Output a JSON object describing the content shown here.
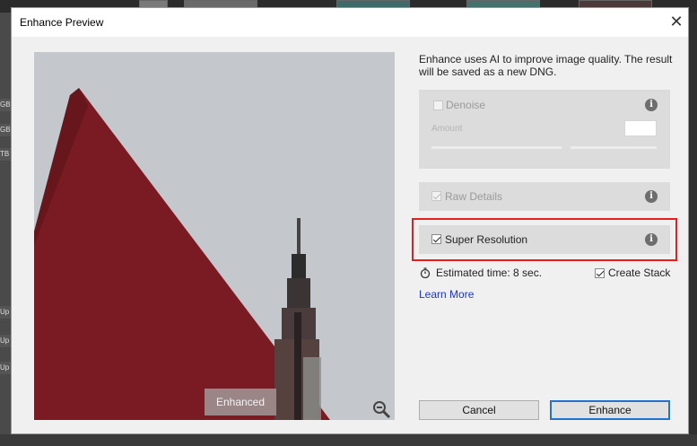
{
  "dialog": {
    "title": "Enhance Preview",
    "close_glyph": "✕",
    "description": "Enhance uses AI to improve image quality. The result will be saved as a new DNG."
  },
  "preview": {
    "overlay_label": "Enhanced",
    "zoom_icon": "zoom-out-icon"
  },
  "options": {
    "denoise": {
      "label": "Denoise",
      "checked": false,
      "enabled": false,
      "amount_label": "Amount"
    },
    "raw_details": {
      "label": "Raw Details",
      "checked": true,
      "enabled": false
    },
    "super_resolution": {
      "label": "Super Resolution",
      "checked": true,
      "enabled": true
    }
  },
  "info_glyph": "i",
  "estimate": {
    "text": "Estimated time: 8 sec."
  },
  "create_stack": {
    "label": "Create Stack",
    "checked": true
  },
  "learn_more": "Learn More",
  "buttons": {
    "cancel": "Cancel",
    "enhance": "Enhance"
  },
  "background": {
    "left_labels": [
      "GB",
      "GB",
      "TB",
      "Up",
      "Up",
      "Up"
    ]
  },
  "colors": {
    "highlight": "#e02020",
    "link": "#1a35c8",
    "primary_border": "#1e73d7",
    "roof_red": "#7a1a22"
  }
}
